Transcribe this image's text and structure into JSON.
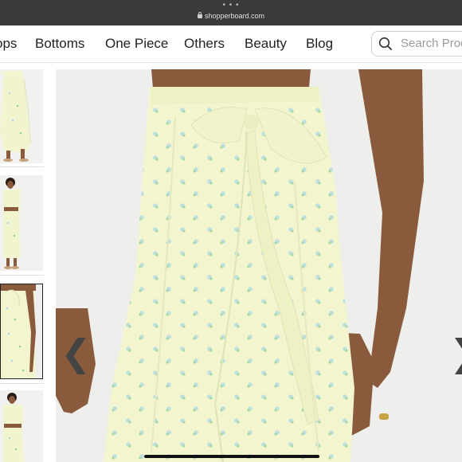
{
  "browser": {
    "domain": "shopperboard.com"
  },
  "nav": {
    "items": [
      "ops",
      "Bottoms",
      "One Piece",
      "Others",
      "Beauty",
      "Blog"
    ],
    "search_placeholder": "Search Prod"
  },
  "gallery": {
    "thumbnails": [
      "thumbnail-1",
      "thumbnail-2",
      "thumbnail-3",
      "thumbnail-4"
    ],
    "selected_index": 2,
    "prev_glyph": "❮",
    "next_glyph": "❯"
  },
  "colors": {
    "skirt": "#f3f5cf",
    "flower_blue": "#a9d8e6",
    "flower_green": "#8ccf97",
    "skin": "#8a5a3c"
  }
}
